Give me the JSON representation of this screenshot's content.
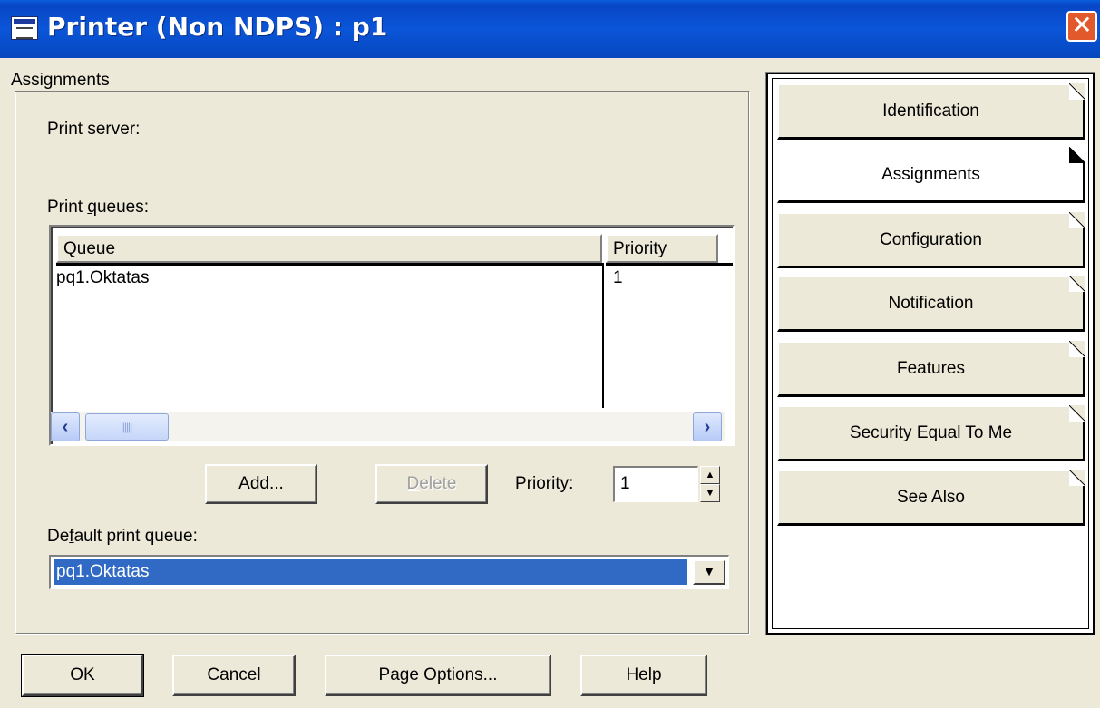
{
  "window": {
    "title": "Printer (Non NDPS) : p1",
    "close_label": "✕"
  },
  "assignments": {
    "section_label": "Assignments",
    "print_server_label": "Print server:",
    "print_queues_label_pre": "Print ",
    "print_queues_label_mnemonic": "q",
    "print_queues_label_post": "ueues:",
    "table": {
      "columns": [
        "Queue",
        "Priority"
      ],
      "rows": [
        {
          "queue": "pq1.Oktatas",
          "priority": "1"
        }
      ]
    },
    "add_button": {
      "mnemonic": "A",
      "rest": "dd..."
    },
    "delete_button": {
      "mnemonic": "D",
      "rest": "elete"
    },
    "priority_label": {
      "mnemonic": "P",
      "rest": "riority:"
    },
    "priority_value": "1",
    "default_queue_label": {
      "pre": "De",
      "mnemonic": "f",
      "post": "ault print queue:"
    },
    "default_queue_value": "pq1.Oktatas"
  },
  "side_tabs": [
    {
      "label": "Identification",
      "active": false
    },
    {
      "label": "Assignments",
      "active": true
    },
    {
      "label": "Configuration",
      "active": false
    },
    {
      "label": "Notification",
      "active": false
    },
    {
      "label": "Features",
      "active": false
    },
    {
      "label": "Security Equal To Me",
      "active": false
    },
    {
      "label": "See Also",
      "active": false
    }
  ],
  "footer_buttons": {
    "ok": "OK",
    "cancel": "Cancel",
    "page_options": "Page Options...",
    "help": "Help"
  }
}
